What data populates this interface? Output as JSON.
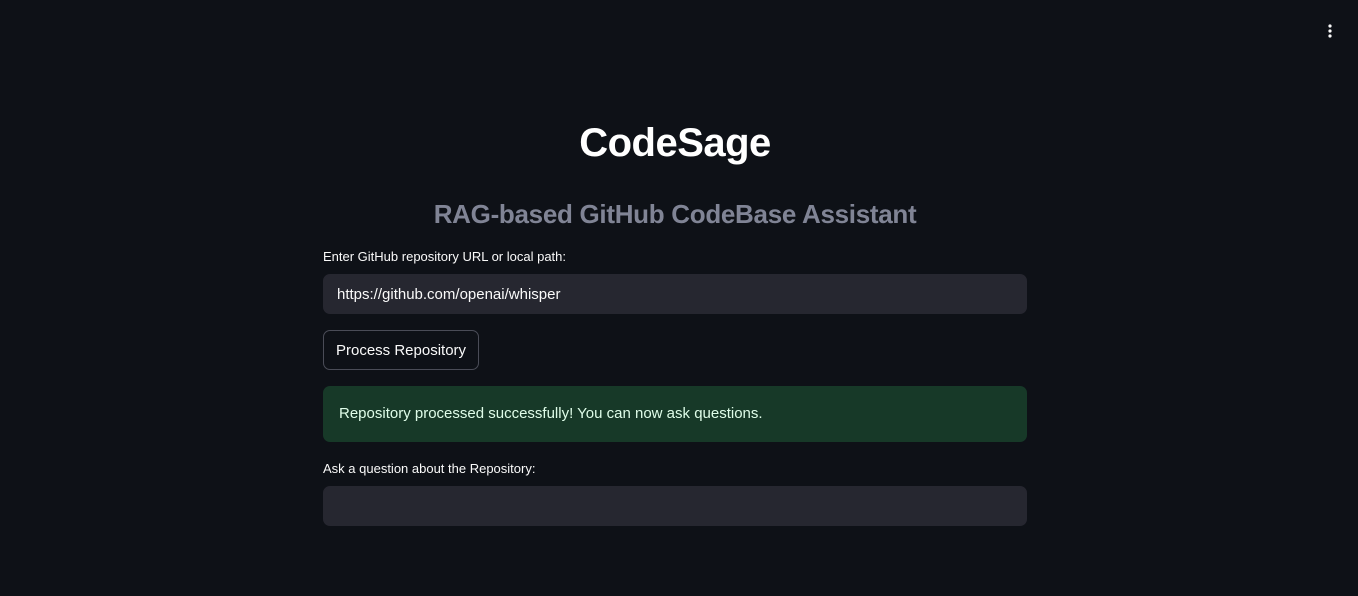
{
  "app": {
    "title": "CodeSage",
    "subtitle": "RAG-based GitHub CodeBase Assistant"
  },
  "header": {
    "menu_icon": "vertical-ellipsis-icon"
  },
  "repo_input": {
    "label": "Enter GitHub repository URL or local path:",
    "value": "https://github.com/openai/whisper",
    "placeholder": ""
  },
  "process_button": {
    "label": "Process Repository"
  },
  "alert": {
    "message": "Repository processed successfully! You can now ask questions.",
    "status_color": "#173928"
  },
  "question_input": {
    "label": "Ask a question about the Repository:",
    "value": "",
    "placeholder": ""
  },
  "colors": {
    "background": "#0e1117",
    "input_background": "#262730",
    "subtitle": "#808495"
  }
}
